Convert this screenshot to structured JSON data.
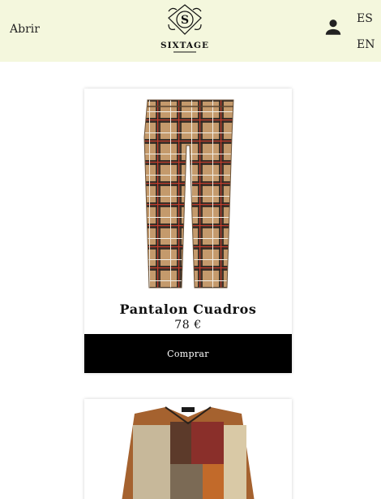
{
  "header": {
    "menu_label": "Abrir",
    "logo_text": "SIXTAGE",
    "languages": [
      "ES",
      "EN"
    ]
  },
  "products": [
    {
      "name": "Pantalon Cuadros",
      "price": "78 €",
      "buy_label": "Comprar"
    },
    {
      "name": "",
      "price": "",
      "buy_label": ""
    }
  ],
  "colors": {
    "header_bg": "#f4f7dd",
    "button_bg": "#000000",
    "plaid_base": "#c49a6c"
  }
}
